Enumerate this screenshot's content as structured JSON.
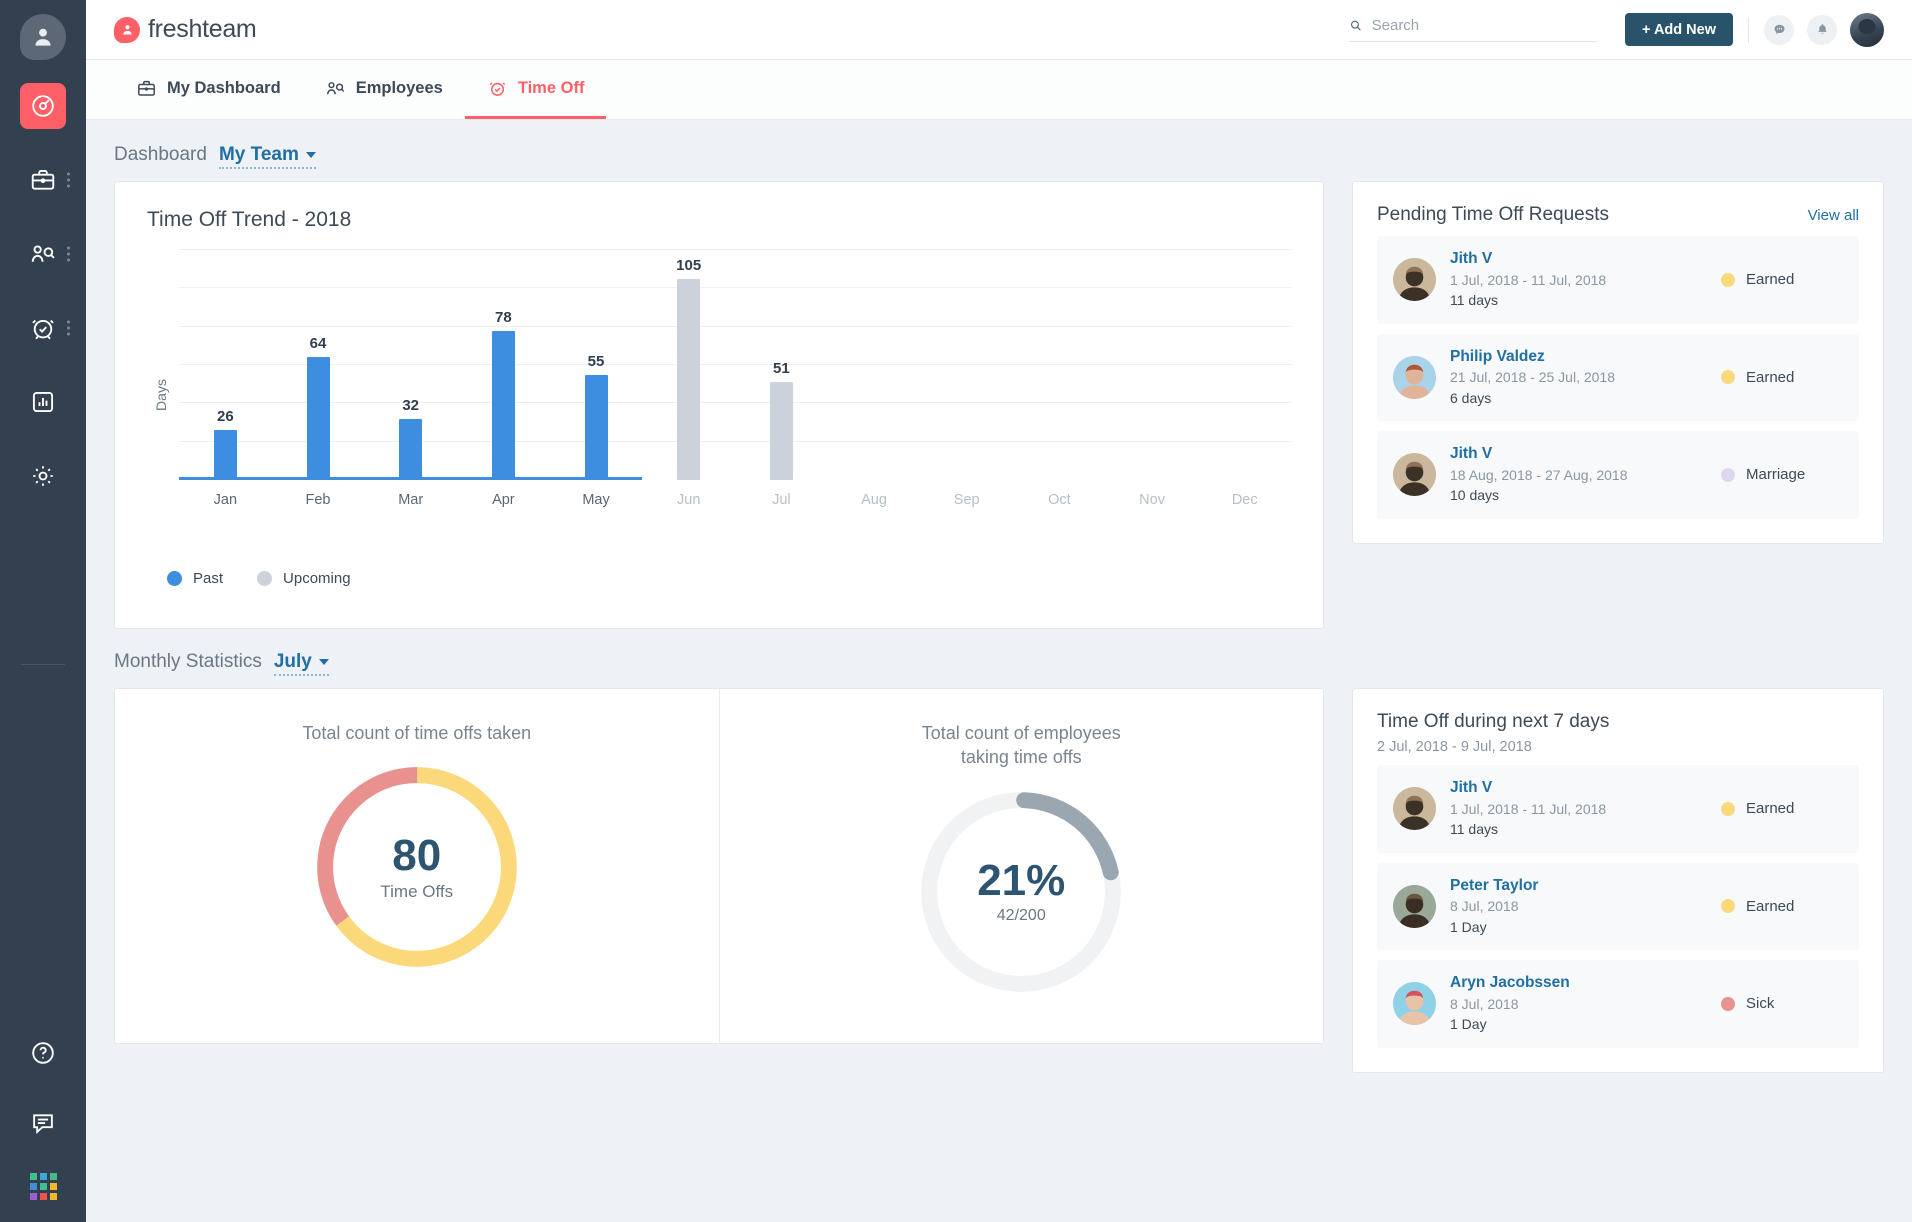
{
  "colors": {
    "brand": "#ff5f67",
    "rail_bg": "#33404f",
    "accent_blue": "#1f6fa3",
    "bar_past": "#3d8ee0",
    "bar_upcoming": "#ccd2d9",
    "earned": "#fbd97a",
    "marriage": "#ddd7f0",
    "sick": "#e8918f",
    "donut_yellow": "#fbd97a",
    "donut_pink": "#e8918f",
    "donut_gray": "#9aa6b0",
    "donut_track": "#f1f2f3",
    "add_new_bg": "#28536b"
  },
  "rail": {
    "items": [
      {
        "name": "profile-avatar",
        "icon": "user-icon"
      },
      {
        "name": "dashboard",
        "icon": "speedometer-icon",
        "active": true
      },
      {
        "name": "jobs",
        "icon": "briefcase-icon",
        "has_menu": true
      },
      {
        "name": "employees",
        "icon": "people-search-icon",
        "has_menu": true
      },
      {
        "name": "time-off",
        "icon": "alarm-check-icon",
        "has_menu": true
      },
      {
        "name": "reports",
        "icon": "bar-chart-icon"
      },
      {
        "name": "settings",
        "icon": "gear-icon"
      }
    ],
    "bottom": [
      {
        "name": "help",
        "icon": "question-circle-icon"
      },
      {
        "name": "feedback",
        "icon": "chat-lines-icon"
      },
      {
        "name": "apps",
        "icon": "app-grid-icon"
      }
    ]
  },
  "header": {
    "logo_text": "freshteam",
    "search": {
      "placeholder": "Search",
      "value": ""
    },
    "add_new_label": "+ Add New",
    "chat_icon": "chat-bubble-icon",
    "bell_icon": "bell-icon",
    "avatar_name": "user-avatar"
  },
  "nav": {
    "tabs": [
      {
        "label": "My Dashboard",
        "icon": "briefcase-icon",
        "active": false
      },
      {
        "label": "Employees",
        "icon": "people-icon",
        "active": false
      },
      {
        "label": "Time Off",
        "icon": "alarm-clock-icon",
        "active": true
      }
    ]
  },
  "dashboard": {
    "section_label": "Dashboard",
    "scope_selected": "My Team"
  },
  "monthly": {
    "section_label": "Monthly Statistics",
    "month_selected": "July"
  },
  "chart_data": {
    "type": "bar",
    "title": "Time Off Trend - 2018",
    "xlabel": "",
    "ylabel": "Days",
    "ylim": [
      0,
      120
    ],
    "grid": true,
    "gridlines": [
      20,
      40,
      60,
      80,
      100,
      120
    ],
    "legend_position": "bottom-left",
    "categories": [
      "Jan",
      "Feb",
      "Mar",
      "Apr",
      "May",
      "Jun",
      "Jul",
      "Aug",
      "Sep",
      "Oct",
      "Nov",
      "Dec"
    ],
    "values": [
      26,
      64,
      32,
      78,
      55,
      105,
      51,
      null,
      null,
      null,
      null,
      null
    ],
    "point_state": [
      "past",
      "past",
      "past",
      "past",
      "past",
      "upcoming",
      "upcoming",
      "upcoming",
      "upcoming",
      "upcoming",
      "upcoming",
      "upcoming"
    ],
    "series": [
      {
        "name": "Past",
        "color": "#3d8ee0",
        "values": [
          26,
          64,
          32,
          78,
          55,
          null,
          null,
          null,
          null,
          null,
          null,
          null
        ]
      },
      {
        "name": "Upcoming",
        "color": "#ccd2d9",
        "values": [
          null,
          null,
          null,
          null,
          null,
          105,
          51,
          null,
          null,
          null,
          null,
          null
        ]
      }
    ],
    "legend": [
      {
        "label": "Past",
        "color": "#3d8ee0"
      },
      {
        "label": "Upcoming",
        "color": "#ccd2d9"
      }
    ]
  },
  "pending": {
    "title": "Pending Time Off Requests",
    "view_all": "View all",
    "rows": [
      {
        "name": "Jith V",
        "dates": "1 Jul, 2018 - 11 Jul, 2018",
        "duration": "11 days",
        "type": "Earned",
        "type_color": "#fbd97a",
        "avatar": "man-short-hair"
      },
      {
        "name": "Philip Valdez",
        "dates": "21 Jul, 2018 - 25 Jul, 2018",
        "duration": "6 days",
        "type": "Earned",
        "type_color": "#fbd97a",
        "avatar": "woman-red-hair"
      },
      {
        "name": "Jith V",
        "dates": "18 Aug, 2018 - 27 Aug, 2018",
        "duration": "10 days",
        "type": "Marriage",
        "type_color": "#ddd7f0",
        "avatar": "man-short-hair"
      }
    ]
  },
  "next7": {
    "title": "Time Off during next 7 days",
    "subtitle": "2 Jul, 2018 - 9 Jul, 2018",
    "rows": [
      {
        "name": "Jith V",
        "dates": "1 Jul, 2018 - 11 Jul, 2018",
        "duration": "11 days",
        "type": "Earned",
        "type_color": "#fbd97a",
        "avatar": "man-short-hair"
      },
      {
        "name": "Peter Taylor",
        "dates": "8 Jul, 2018",
        "duration": "1 Day",
        "type": "Earned",
        "type_color": "#fbd97a",
        "avatar": "man-beard"
      },
      {
        "name": "Aryn Jacobssen",
        "dates": "8 Jul, 2018",
        "duration": "1 Day",
        "type": "Sick",
        "type_color": "#e8918f",
        "avatar": "woman-helmet"
      }
    ]
  },
  "stats": {
    "left": {
      "label": "Total count of time offs taken",
      "big_value": "80",
      "sub_value": "Time Offs",
      "donut": {
        "type": "pie",
        "segments": [
          {
            "name": "segment-a",
            "color": "#fbd97a",
            "percent": 65
          },
          {
            "name": "segment-b",
            "color": "#e8918f",
            "percent": 35
          }
        ]
      }
    },
    "right": {
      "label": "Total count of employees taking time offs",
      "big_value": "21%",
      "sub_value": "42/200",
      "donut": {
        "type": "gauge",
        "percent": 21,
        "fill_color": "#9aa6b0",
        "track_color": "#f1f2f3"
      }
    }
  }
}
